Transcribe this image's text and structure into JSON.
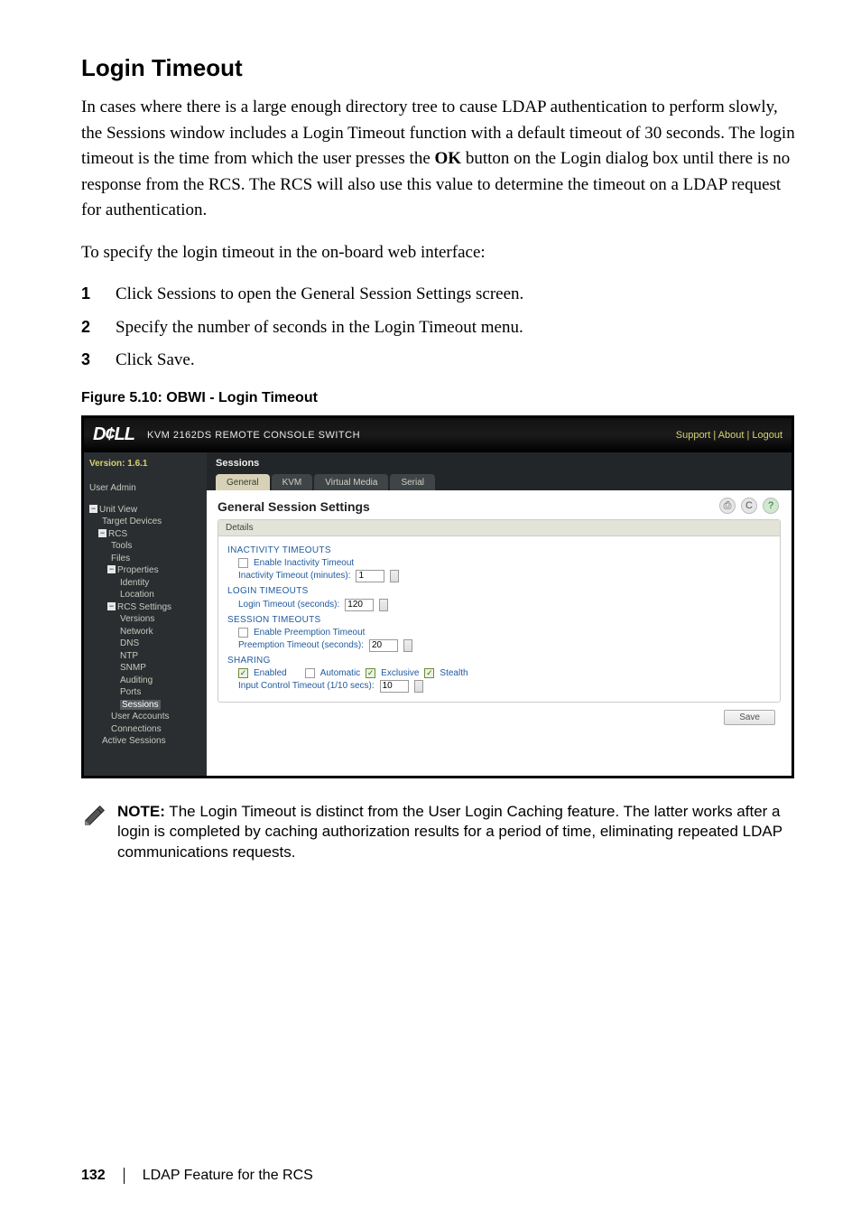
{
  "section": {
    "title": "Login Timeout",
    "para1_a": "In cases where there is a large enough directory tree to cause LDAP authentication to perform slowly, the Sessions window includes a Login Timeout function with a default timeout of 30 seconds. The login timeout is the time from which the user presses the ",
    "para1_bold": "OK",
    "para1_b": " button on the Login dialog box until there is no response from the RCS. The RCS will also use this value to determine the timeout on a LDAP request for authentication.",
    "para2": "To specify the login timeout in the on-board web interface:",
    "steps": [
      {
        "num": "1",
        "pre": "Click ",
        "bold": "Sessions",
        "post": " to open the General Session Settings screen."
      },
      {
        "num": "2",
        "pre": "Specify the number of seconds in the Login Timeout menu.",
        "bold": "",
        "post": ""
      },
      {
        "num": "3",
        "pre": "Click ",
        "bold": "Save",
        "post": "."
      }
    ],
    "figure_caption": "Figure 5.10: OBWI - Login Timeout"
  },
  "obwi": {
    "logo": "D¢LL",
    "top_title": "KVM 2162DS REMOTE CONSOLE SWITCH",
    "top_links": "Support  |  About  |  Logout",
    "version": "Version: 1.6.1",
    "user": "User Admin",
    "tree": {
      "unit_view": "Unit View",
      "target_devices": "Target Devices",
      "rcs": "RCS",
      "tools": "Tools",
      "files": "Files",
      "properties": "Properties",
      "identity": "Identity",
      "location": "Location",
      "rcs_settings": "RCS Settings",
      "versions": "Versions",
      "network": "Network",
      "dns": "DNS",
      "ntp": "NTP",
      "snmp": "SNMP",
      "auditing": "Auditing",
      "ports": "Ports",
      "sessions": "Sessions",
      "user_accounts": "User Accounts",
      "connections": "Connections",
      "active_sessions": "Active Sessions"
    },
    "tabs_title": "Sessions",
    "tabs": {
      "general": "General",
      "kvm": "KVM",
      "vm": "Virtual Media",
      "serial": "Serial"
    },
    "content": {
      "heading": "General Session Settings",
      "details": "Details",
      "inactivity_title": "INACTIVITY TIMEOUTS",
      "enable_inactivity": "Enable Inactivity Timeout",
      "inactivity_label": "Inactivity Timeout (minutes):",
      "inactivity_value": "1",
      "login_title": "LOGIN TIMEOUTS",
      "login_label": "Login Timeout (seconds):",
      "login_value": "120",
      "session_title": "SESSION TIMEOUTS",
      "enable_preempt": "Enable Preemption Timeout",
      "preempt_label": "Preemption Timeout (seconds):",
      "preempt_value": "20",
      "sharing_title": "SHARING",
      "enabled": "Enabled",
      "automatic": "Automatic",
      "exclusive": "Exclusive",
      "stealth": "Stealth",
      "input_control_label": "Input Control Timeout (1/10 secs):",
      "input_control_value": "10",
      "save": "Save"
    },
    "icons": {
      "print": "⎙",
      "refresh": "C",
      "help": "?"
    }
  },
  "note": {
    "label": "NOTE:",
    "text": " The Login Timeout is distinct from the User Login Caching feature. The latter works after a login is completed by caching authorization results for a period of time, eliminating repeated LDAP communications requests."
  },
  "footer": {
    "page": "132",
    "chapter": "LDAP Feature for the RCS"
  }
}
